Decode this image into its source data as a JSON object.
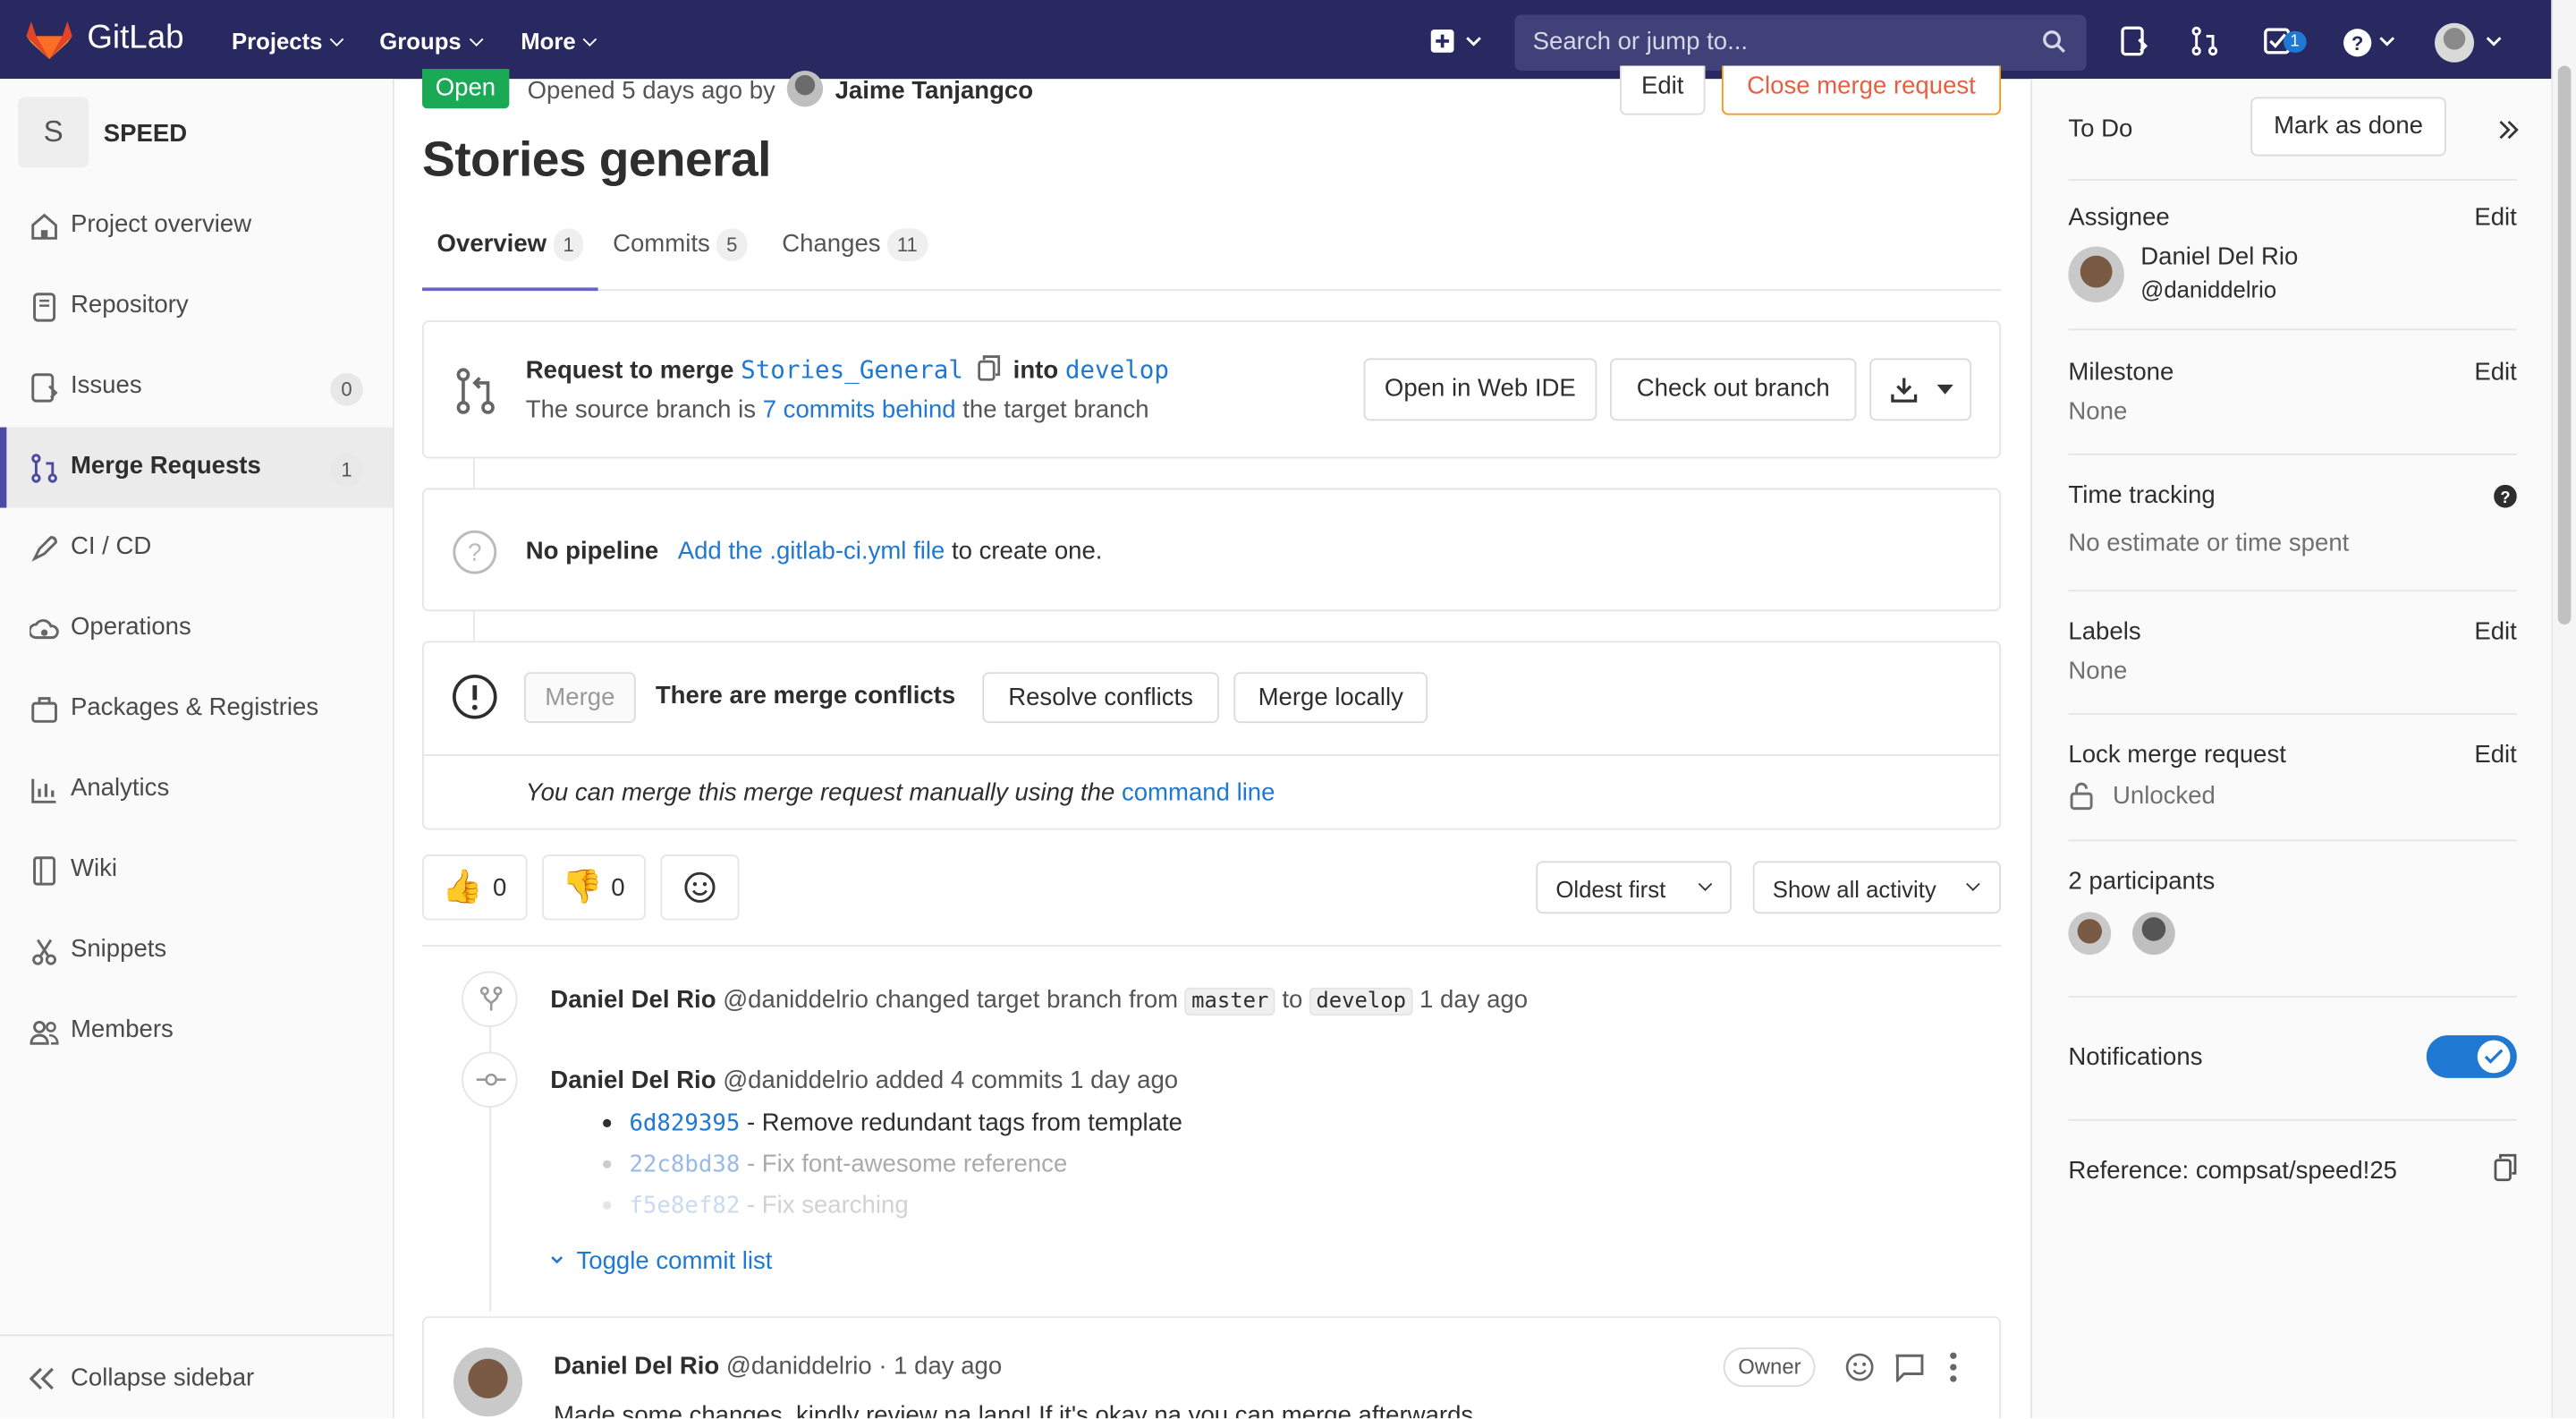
{
  "topnav": {
    "brand": "GitLab",
    "menus": [
      "Projects",
      "Groups",
      "More"
    ],
    "search_placeholder": "Search or jump to...",
    "todo_count": "1"
  },
  "sidebar": {
    "project_initial": "S",
    "project_name": "SPEED",
    "items": [
      {
        "label": "Project overview"
      },
      {
        "label": "Repository"
      },
      {
        "label": "Issues",
        "count": "0"
      },
      {
        "label": "Merge Requests",
        "count": "1"
      },
      {
        "label": "CI / CD"
      },
      {
        "label": "Operations"
      },
      {
        "label": "Packages & Registries"
      },
      {
        "label": "Analytics"
      },
      {
        "label": "Wiki"
      },
      {
        "label": "Snippets"
      },
      {
        "label": "Members"
      }
    ],
    "collapse_label": "Collapse sidebar"
  },
  "mr": {
    "status": "Open",
    "opened_text": "Opened 5 days ago by",
    "author": "Jaime Tanjangco",
    "edit_label": "Edit",
    "close_label": "Close merge request",
    "title": "Stories general",
    "tabs": [
      {
        "label": "Overview",
        "count": "1"
      },
      {
        "label": "Commits",
        "count": "5"
      },
      {
        "label": "Changes",
        "count": "11"
      }
    ]
  },
  "widget": {
    "request_prefix": "Request to merge",
    "source_branch": "Stories_General",
    "into": "into",
    "target_branch": "develop",
    "behind_prefix": "The source branch is",
    "behind_link": "7 commits behind",
    "behind_suffix": "the target branch",
    "open_ide": "Open in Web IDE",
    "checkout": "Check out branch"
  },
  "pipeline": {
    "label": "No pipeline",
    "link": "Add the .gitlab-ci.yml file",
    "suffix": "to create one."
  },
  "merge": {
    "merge_btn": "Merge",
    "conflicts": "There are merge conflicts",
    "resolve": "Resolve conflicts",
    "locally": "Merge locally",
    "manual_text": "You can merge this merge request manually using the",
    "manual_link": "command line"
  },
  "reactions": {
    "thumbs_up": "0",
    "thumbs_down": "0"
  },
  "filters": {
    "sort": "Oldest first",
    "activity": "Show all activity"
  },
  "timeline": {
    "event1": {
      "name": "Daniel Del Rio",
      "handle": "@daniddelrio",
      "text": "changed target branch from",
      "from": "master",
      "to_word": "to",
      "to": "develop",
      "time": "1 day ago"
    },
    "event2": {
      "name": "Daniel Del Rio",
      "handle": "@daniddelrio",
      "text": "added 4 commits 1 day ago"
    },
    "commits": [
      {
        "sha": "6d829395",
        "msg": "- Remove redundant tags from template"
      },
      {
        "sha": "22c8bd38",
        "msg": "- Fix font-awesome reference"
      },
      {
        "sha": "f5e8ef82",
        "msg": "- Fix searching"
      }
    ],
    "toggle": "Toggle commit list",
    "note": {
      "name": "Daniel Del Rio",
      "handle": "@daniddelrio",
      "time": "· 1 day ago",
      "role": "Owner",
      "body": "Made some changes, kindly review na lang! If it's okay na you can merge afterwards."
    }
  },
  "right": {
    "todo": "To Do",
    "mark_done": "Mark as done",
    "assignee_label": "Assignee",
    "edit": "Edit",
    "assignee_name": "Daniel Del Rio",
    "assignee_handle": "@daniddelrio",
    "milestone_label": "Milestone",
    "milestone_value": "None",
    "time_label": "Time tracking",
    "time_value": "No estimate or time spent",
    "labels_label": "Labels",
    "labels_value": "None",
    "lock_label": "Lock merge request",
    "lock_value": "Unlocked",
    "participants": "2 participants",
    "notifications": "Notifications",
    "reference": "Reference: compsat/speed!25"
  }
}
